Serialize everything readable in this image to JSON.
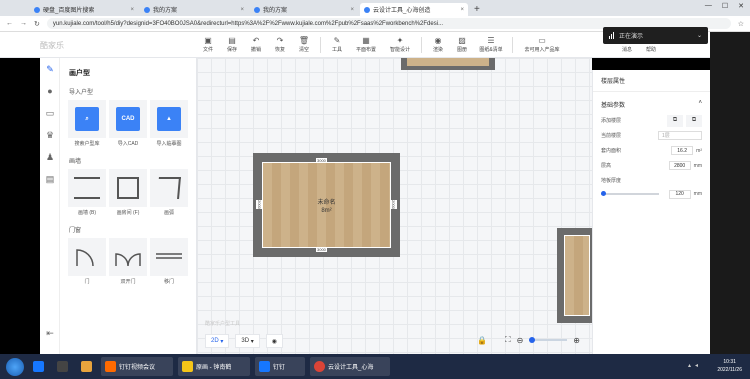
{
  "browser": {
    "tabs": [
      {
        "label": "硬盘_百度图片搜索",
        "active": false
      },
      {
        "label": "我的方案",
        "active": false
      },
      {
        "label": "我的方案",
        "active": false
      },
      {
        "label": "云设计工具_心海创造",
        "active": true
      }
    ],
    "new_tab": "+",
    "url": "yun.kujiale.com/tool/h5/diy?designid=3FO40BO0JSA0&redirecturl=https%3A%2F%2Fwww.kujiale.com%2Fpub%2Fsaas%2Fworkbench%2Fdesi..."
  },
  "app": {
    "logo": "酷家乐",
    "toolbar": [
      {
        "icon": "folder",
        "label": "文件"
      },
      {
        "icon": "save",
        "label": "保存"
      },
      {
        "icon": "undo",
        "label": "撤销"
      },
      {
        "icon": "redo",
        "label": "恢复"
      },
      {
        "icon": "trash",
        "label": "清空"
      }
    ],
    "toolbar2": [
      {
        "icon": "wrench",
        "label": "工具"
      },
      {
        "icon": "layout",
        "label": "平面布置"
      },
      {
        "icon": "smart",
        "label": "智能设计"
      }
    ],
    "toolbar3": [
      {
        "icon": "camera",
        "label": "渲染"
      },
      {
        "icon": "image",
        "label": "图册"
      },
      {
        "icon": "list",
        "label": "图纸&清单"
      }
    ],
    "toolbar4": [
      {
        "icon": "cart",
        "label": "去可用入产品库"
      }
    ],
    "right_tools": [
      {
        "icon": "calendar",
        "label": "消息"
      },
      {
        "icon": "help",
        "label": "帮助"
      }
    ]
  },
  "meeting": {
    "status": "正在演示"
  },
  "library": {
    "title": "画户型",
    "section_import": "导入户型",
    "import_items": [
      "搜索户型库",
      "导入CAD",
      "导入临摹图"
    ],
    "section_wall": "画墙",
    "wall_items": [
      "画墙 (B)",
      "画房间 (F)",
      "画弧"
    ],
    "section_door": "门窗",
    "door_items": [
      "门",
      "双开门",
      "移门"
    ]
  },
  "canvas": {
    "room_name": "未命名",
    "room_area": "8m²",
    "dim_top": "3000",
    "dim_bottom": "3000",
    "dim_left": "2000",
    "dim_right": "2000",
    "watermark": "酷家乐户型工具",
    "view_2d": "2D",
    "view_3d": "3D"
  },
  "props": {
    "title": "楼层属性",
    "section": "基础参数",
    "rows": [
      {
        "key": "添加楼层"
      },
      {
        "key": "当前楼层",
        "value": "1层"
      },
      {
        "key": "套内面积",
        "value": "16.2",
        "unit": "m²"
      },
      {
        "key": "层高",
        "value": "2800",
        "unit": "mm"
      },
      {
        "key": "地板厚度",
        "value": "120",
        "unit": "mm"
      }
    ]
  },
  "taskbar": {
    "apps": [
      "钉钉视频会议",
      "原画 - 钟南鹤",
      "钉钉",
      "云设计工具_心海"
    ],
    "time": "10:31",
    "date": "2022/11/26"
  }
}
